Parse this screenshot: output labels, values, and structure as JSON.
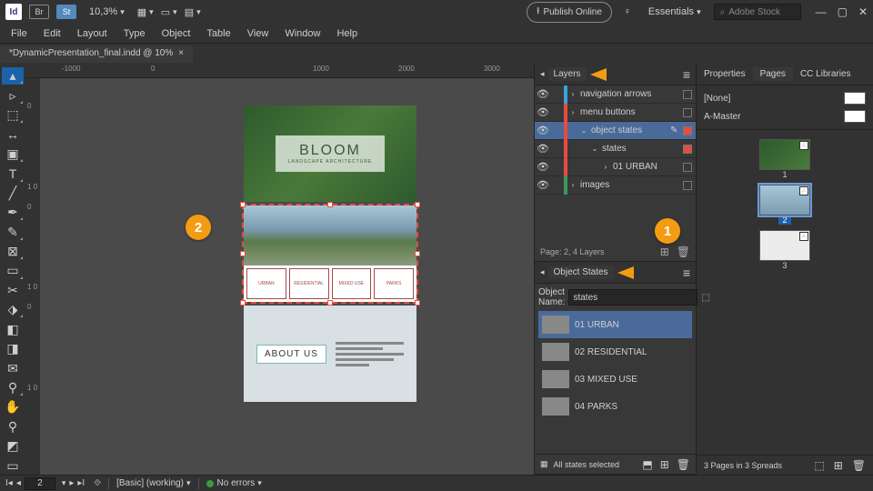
{
  "titlebar": {
    "app_abbr": "Id",
    "br_abbr": "Br",
    "st_abbr": "St",
    "zoom": "10,3%",
    "publish": "Publish Online",
    "workspace": "Essentials",
    "search_placeholder": "Adobe Stock"
  },
  "menubar": [
    "File",
    "Edit",
    "Layout",
    "Type",
    "Object",
    "Table",
    "View",
    "Window",
    "Help"
  ],
  "doc_tab": {
    "title": "*DynamicPresentation_final.indd @ 10%"
  },
  "ruler_h": [
    "-1000",
    "0",
    "1000",
    "2000",
    "3000"
  ],
  "ruler_v": [
    "0",
    "1 0",
    "0",
    "1 0",
    "0",
    "1 0"
  ],
  "slide1": {
    "big": "BLOOM",
    "small": "LANDSCAPE ARCHITECTURE"
  },
  "slide2_cards": [
    "URBAN",
    "RESIDENTIAL",
    "MIXED USE",
    "PARKS"
  ],
  "slide3": {
    "title": "ABOUT US"
  },
  "callouts": {
    "one": "1",
    "two": "2"
  },
  "layers_panel": {
    "title": "Layers",
    "rows": [
      {
        "vis": true,
        "color": "#3aa0e0",
        "indent": 0,
        "twist": "›",
        "name": "navigation arrows",
        "sel": false,
        "filled": false
      },
      {
        "vis": true,
        "color": "#e74c3c",
        "indent": 0,
        "twist": "›",
        "name": "menu buttons",
        "sel": false,
        "filled": false
      },
      {
        "vis": true,
        "color": "#e74c3c",
        "indent": 1,
        "twist": "⌄",
        "name": "object states",
        "sel": true,
        "pen": true,
        "filled": true
      },
      {
        "vis": true,
        "color": "#e74c3c",
        "indent": 2,
        "twist": "⌄",
        "name": "states",
        "sel": false,
        "filled": true
      },
      {
        "vis": true,
        "color": "#e74c3c",
        "indent": 3,
        "twist": "›",
        "name": "01 URBAN",
        "sel": false,
        "filled": false
      },
      {
        "vis": true,
        "color": "#3a9a5a",
        "indent": 0,
        "twist": "›",
        "name": "images",
        "sel": false,
        "filled": false
      }
    ],
    "footer": "Page: 2, 4 Layers"
  },
  "object_states": {
    "title": "Object States",
    "name_label": "Object Name:",
    "name_value": "states",
    "states": [
      {
        "label": "01 URBAN",
        "sel": true
      },
      {
        "label": "02 RESIDENTIAL",
        "sel": false
      },
      {
        "label": "03 MIXED USE",
        "sel": false
      },
      {
        "label": "04 PARKS",
        "sel": false
      }
    ],
    "footer": "All states selected"
  },
  "right": {
    "tabs": [
      "Properties",
      "Pages",
      "CC Libraries"
    ],
    "active_tab": 1,
    "masters": [
      {
        "name": "[None]"
      },
      {
        "name": "A-Master"
      }
    ],
    "pages": [
      {
        "num": "1",
        "sel": false
      },
      {
        "num": "2",
        "sel": true
      },
      {
        "num": "3",
        "sel": false
      }
    ],
    "footer": "3 Pages in 3 Spreads"
  },
  "status": {
    "page_value": "2",
    "layout": "[Basic] (working)",
    "errors": "No errors"
  }
}
